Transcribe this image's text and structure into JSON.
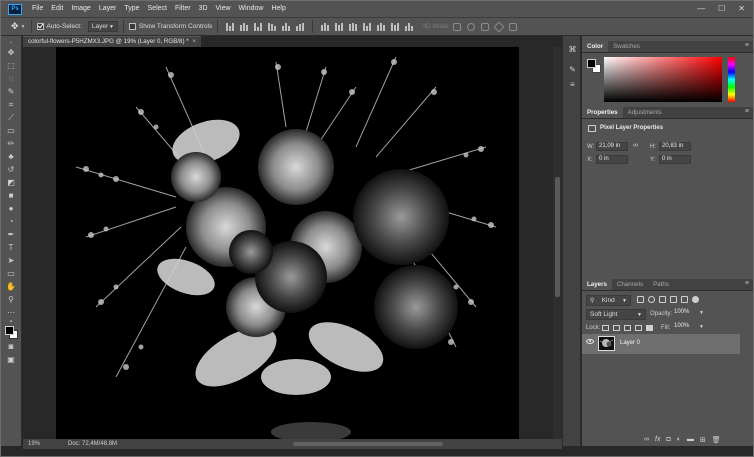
{
  "app": {
    "logo": "Ps"
  },
  "menu": [
    "File",
    "Edit",
    "Image",
    "Layer",
    "Type",
    "Select",
    "Filter",
    "3D",
    "View",
    "Window",
    "Help"
  ],
  "window_controls": {
    "minimize": "—",
    "maximize": "☐",
    "close": "✕"
  },
  "options": {
    "auto_select_label": "Auto-Select:",
    "auto_select_value": "Layer",
    "show_transform_label": "Show Transform Controls",
    "mode_3d_label": "3D Mode:"
  },
  "document": {
    "tab_title": "colorful-flowers-P5HZMX3.JPG @ 19% (Layer 0, RGB/8) *",
    "tab_close": "×"
  },
  "status": {
    "zoom": "19%",
    "doc_info": "Doc: 72,4M/48,8M"
  },
  "color_panel": {
    "tabs": [
      "Color",
      "Swatches"
    ],
    "foreground": "#000000",
    "background": "#ffffff"
  },
  "properties_panel": {
    "tabs": [
      "Properties",
      "Adjustments"
    ],
    "section_title": "Pixel Layer Properties",
    "w_label": "W:",
    "w_value": "21,09 in",
    "h_label": "H:",
    "h_value": "20,83 in",
    "x_label": "X:",
    "x_value": "0 in",
    "y_label": "Y:",
    "y_value": "0 in",
    "link_icon": "∞"
  },
  "layers_panel": {
    "tabs": [
      "Layers",
      "Channels",
      "Paths"
    ],
    "kind_label": "Kind",
    "blend_mode": "Soft Light",
    "opacity_label": "Opacity:",
    "opacity_value": "100%",
    "lock_label": "Lock:",
    "fill_label": "Fill:",
    "fill_value": "100%",
    "layers": [
      {
        "name": "Layer 0",
        "visible": true,
        "selected": true
      }
    ],
    "bottom_icons": [
      "link-icon",
      "fx-icon",
      "mask-icon",
      "adjustment-icon",
      "folder-icon",
      "new-layer-icon",
      "trash-icon"
    ]
  },
  "colors": {
    "panel_bg": "#535353",
    "dark_bg": "#282828",
    "selection": "#6f6f6f"
  }
}
